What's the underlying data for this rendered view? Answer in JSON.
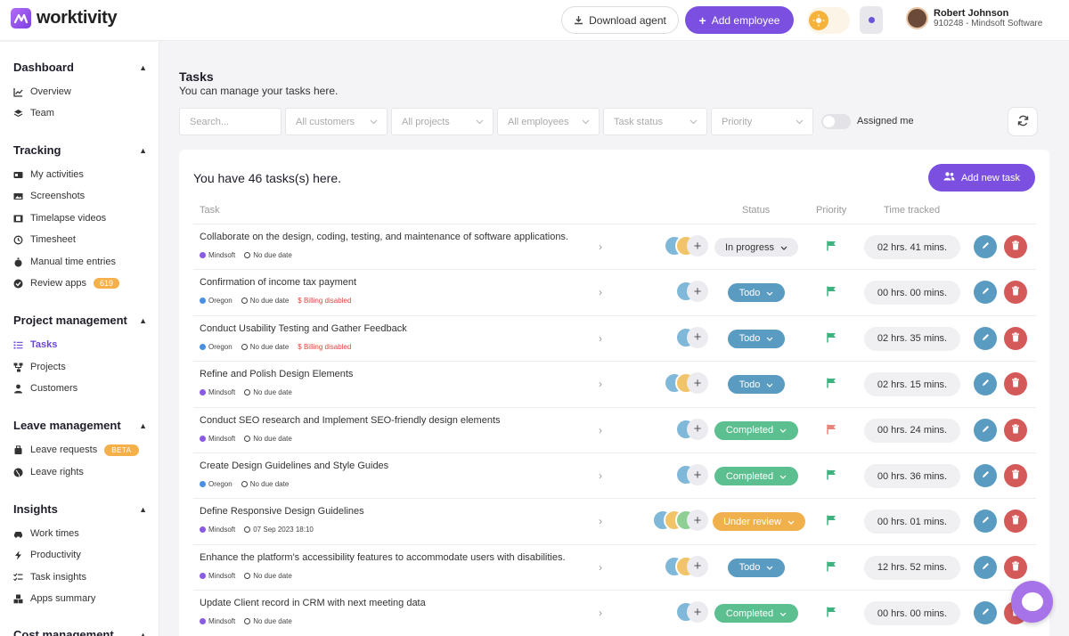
{
  "app": {
    "brand": "worktivity"
  },
  "header": {
    "download_label": "Download agent",
    "add_employee_label": "Add employee",
    "user_name": "Robert Johnson",
    "user_sub": "910248 - Mindsoft Software"
  },
  "sidebar": {
    "sections": [
      {
        "title": "Dashboard",
        "items": [
          {
            "label": "Overview",
            "icon": "chart-line-icon"
          },
          {
            "label": "Team",
            "icon": "layers-icon"
          }
        ]
      },
      {
        "title": "Tracking",
        "items": [
          {
            "label": "My activities",
            "icon": "id-card-icon"
          },
          {
            "label": "Screenshots",
            "icon": "images-icon"
          },
          {
            "label": "Timelapse videos",
            "icon": "film-icon"
          },
          {
            "label": "Timesheet",
            "icon": "history-icon"
          },
          {
            "label": "Manual time entries",
            "icon": "stopwatch-icon"
          },
          {
            "label": "Review apps",
            "icon": "check-circle-icon",
            "badge": "619"
          }
        ]
      },
      {
        "title": "Project management",
        "items": [
          {
            "label": "Tasks",
            "icon": "list-icon",
            "active": true
          },
          {
            "label": "Projects",
            "icon": "sitemap-icon"
          },
          {
            "label": "Customers",
            "icon": "user-icon"
          }
        ]
      },
      {
        "title": "Leave management",
        "items": [
          {
            "label": "Leave requests",
            "icon": "suitcase-icon",
            "badge": "BETA"
          },
          {
            "label": "Leave rights",
            "icon": "globe-icon"
          }
        ]
      },
      {
        "title": "Insights",
        "items": [
          {
            "label": "Work times",
            "icon": "car-icon"
          },
          {
            "label": "Productivity",
            "icon": "bolt-icon"
          },
          {
            "label": "Task insights",
            "icon": "tasks-icon"
          },
          {
            "label": "Apps summary",
            "icon": "cubes-icon"
          }
        ]
      },
      {
        "title": "Cost management",
        "items": []
      }
    ]
  },
  "main": {
    "title": "Tasks",
    "subtitle": "You can manage your tasks here.",
    "filters": {
      "search_placeholder": "Search...",
      "customers": "All customers",
      "projects": "All projects",
      "employees": "All employees",
      "status": "Task status",
      "priority": "Priority",
      "assigned_me": "Assigned me"
    },
    "card_title": "You have 46 tasks(s) here.",
    "add_task_label": "Add new task",
    "columns": {
      "task": "Task",
      "status": "Status",
      "priority": "Priority",
      "time": "Time tracked"
    },
    "colors": {
      "accent": "#7b4fe0",
      "in_progress": "#ececf0",
      "todo": "#5a9bc2",
      "completed": "#5bbf8f",
      "under_review": "#f0b14d",
      "flag_green": "#3fb37f",
      "flag_red": "#e8857a"
    },
    "tasks": [
      {
        "name": "Collaborate on the design, coding, testing, and maintenance of software applications.",
        "customer": "Mindsoft",
        "customer_color": "#8a5ae0",
        "due": "No due date",
        "billing": "",
        "status": "In progress",
        "status_key": "in_progress",
        "priority_flag": "green",
        "time": "02 hrs. 41 mins.",
        "avatars": 2
      },
      {
        "name": "Confirmation of income tax payment",
        "customer": "Oregon",
        "customer_color": "#4a8fe0",
        "due": "No due date",
        "billing": "$ Billing disabled",
        "status": "Todo",
        "status_key": "todo",
        "priority_flag": "green",
        "time": "00 hrs. 00 mins.",
        "avatars": 1
      },
      {
        "name": "Conduct Usability Testing and Gather Feedback",
        "customer": "Oregon",
        "customer_color": "#4a8fe0",
        "due": "No due date",
        "billing": "$ Billing disabled",
        "status": "Todo",
        "status_key": "todo",
        "priority_flag": "green",
        "time": "02 hrs. 35 mins.",
        "avatars": 1
      },
      {
        "name": "Refine and Polish Design Elements",
        "customer": "Mindsoft",
        "customer_color": "#8a5ae0",
        "due": "No due date",
        "billing": "",
        "status": "Todo",
        "status_key": "todo",
        "priority_flag": "green",
        "time": "02 hrs. 15 mins.",
        "avatars": 2
      },
      {
        "name": "Conduct SEO research and Implement SEO-friendly design elements",
        "customer": "Mindsoft",
        "customer_color": "#8a5ae0",
        "due": "No due date",
        "billing": "",
        "status": "Completed",
        "status_key": "completed",
        "priority_flag": "red",
        "time": "00 hrs. 24 mins.",
        "avatars": 1
      },
      {
        "name": "Create Design Guidelines and Style Guides",
        "customer": "Oregon",
        "customer_color": "#4a8fe0",
        "due": "No due date",
        "billing": "",
        "status": "Completed",
        "status_key": "completed",
        "priority_flag": "green",
        "time": "00 hrs. 36 mins.",
        "avatars": 1
      },
      {
        "name": "Define Responsive Design Guidelines",
        "customer": "Mindsoft",
        "customer_color": "#8a5ae0",
        "due": "07 Sep 2023 18:10",
        "billing": "",
        "status": "Under review",
        "status_key": "under_review",
        "priority_flag": "green",
        "time": "00 hrs. 01 mins.",
        "avatars": 3
      },
      {
        "name": "Enhance the platform's accessibility features to accommodate users with disabilities.",
        "customer": "Mindsoft",
        "customer_color": "#8a5ae0",
        "due": "No due date",
        "billing": "",
        "status": "Todo",
        "status_key": "todo",
        "priority_flag": "green",
        "time": "12 hrs. 52 mins.",
        "avatars": 2
      },
      {
        "name": "Update Client record in CRM with next meeting data",
        "customer": "Mindsoft",
        "customer_color": "#8a5ae0",
        "due": "No due date",
        "billing": "",
        "status": "Completed",
        "status_key": "completed",
        "priority_flag": "green",
        "time": "00 hrs. 00 mins.",
        "avatars": 1
      }
    ]
  }
}
